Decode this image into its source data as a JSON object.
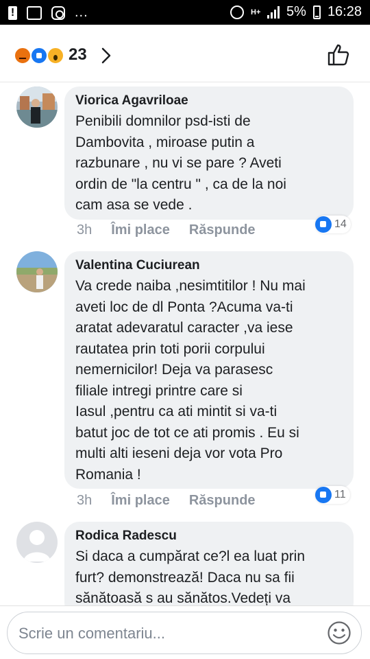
{
  "status_bar": {
    "battery": "5%",
    "time": "16:28",
    "network": "H+",
    "more": "..."
  },
  "reactions": {
    "count": "23",
    "icons": [
      "angry-icon",
      "like-icon",
      "wow-icon"
    ]
  },
  "comments": [
    {
      "name": "Viorica Agavriloae",
      "text": "Penibili domnilor psd-isti de\nDambovita , miroase putin a\nrazbunare , nu vi se pare ? Aveti\nordin de \"la centru \" , ca de la noi\ncam asa se vede .",
      "time": "3h",
      "like_label": "Îmi place",
      "reply_label": "Răspunde",
      "likes": "14"
    },
    {
      "name": "Valentina Cuciurean",
      "text": "Va crede naiba ,nesimtitilor ! Nu mai\naveti loc de dl Ponta ?Acuma va-ti\naratat adevaratul caracter ,va iese\nrautatea prin toti porii corpului\nnemernicilor! Deja va parasesc\nfiliale intregi printre care si\nIasul ,pentru ca ati mintit si va-ti\nbatut joc de tot ce ati promis . Eu si\nmulti alti ieseni deja vor vota Pro\nRomania !",
      "time": "3h",
      "like_label": "Îmi place",
      "reply_label": "Răspunde",
      "likes": "11"
    },
    {
      "name": "Rodica Radescu",
      "text": "Si daca a cumpărat ce?l ea luat prin\nfurt? demonstrează! Daca nu sa fii\nsănătoasă s au sănătos.Vedeți va"
    }
  ],
  "composer": {
    "placeholder": "Scrie un comentariu..."
  }
}
